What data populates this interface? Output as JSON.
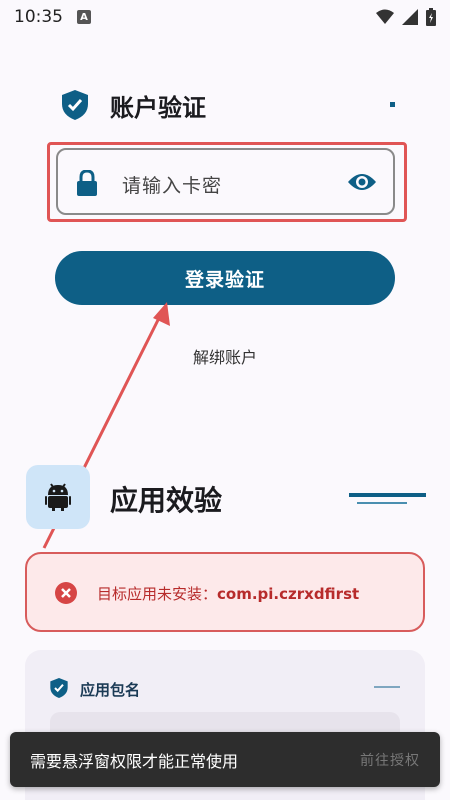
{
  "status_bar": {
    "time": "10:35",
    "app_icon_letter": "A"
  },
  "account": {
    "title": "账户验证",
    "input_placeholder": "请输入卡密",
    "login_label": "登录验证",
    "unbind_label": "解绑账户"
  },
  "app_verify": {
    "title": "应用效验",
    "error_prefix": "目标应用未安装：",
    "error_package": "com.pi.czrxdfirst",
    "package_label": "应用包名"
  },
  "toast": {
    "message": "需要悬浮窗权限才能正常使用",
    "action": "前往授权"
  },
  "colors": {
    "primary": "#0e5f86",
    "error": "#b72b2b",
    "annotation_red": "#e05555"
  },
  "icons": [
    "shield-check-icon",
    "lock-icon",
    "eye-icon",
    "android-icon",
    "error-x-icon",
    "wifi-icon",
    "signal-icon",
    "battery-icon"
  ]
}
